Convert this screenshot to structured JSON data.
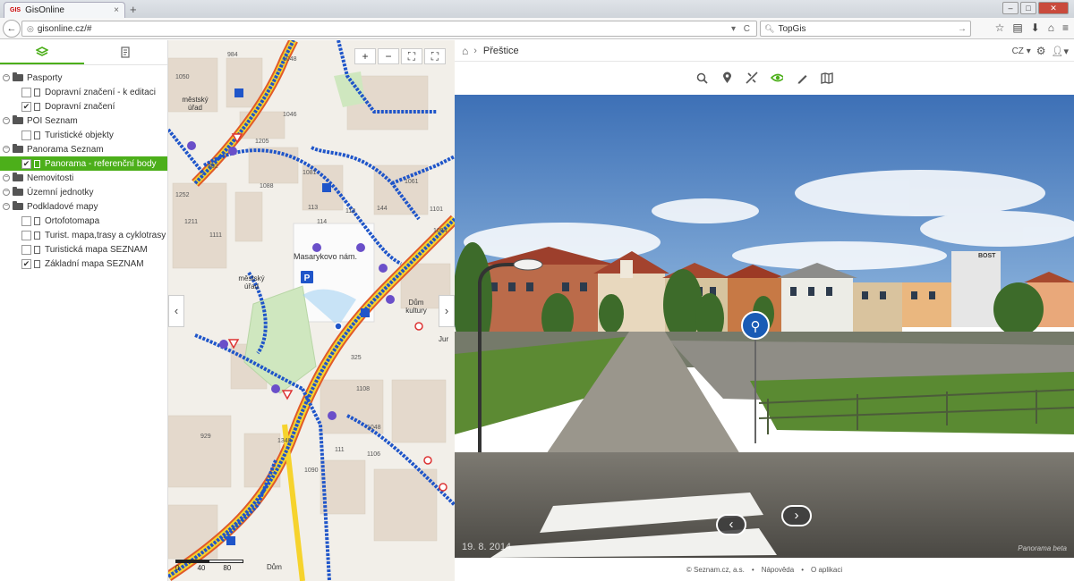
{
  "browser": {
    "tab_title": "GisOnline",
    "tab_favicon": "GIS",
    "url": "gisonline.cz/#",
    "search_value": "TopGis"
  },
  "panel": {
    "tree": [
      {
        "type": "group",
        "label": "Pasporty"
      },
      {
        "type": "item",
        "label": "Dopravní značení - k editaci",
        "checked": false
      },
      {
        "type": "item",
        "label": "Dopravní značení",
        "checked": true
      },
      {
        "type": "group",
        "label": "POI Seznam"
      },
      {
        "type": "item",
        "label": "Turistické objekty",
        "checked": false
      },
      {
        "type": "group",
        "label": "Panorama Seznam"
      },
      {
        "type": "item",
        "label": "Panorama - referenční body",
        "checked": true,
        "selected": true
      },
      {
        "type": "group",
        "label": "Nemovitosti"
      },
      {
        "type": "group",
        "label": "Územní jednotky"
      },
      {
        "type": "group",
        "label": "Podkladové mapy"
      },
      {
        "type": "item",
        "label": "Ortofotomapa",
        "checked": false
      },
      {
        "type": "item",
        "label": "Turist. mapa,trasy a cyklotrasy",
        "checked": false
      },
      {
        "type": "item",
        "label": "Turistická mapa SEZNAM",
        "checked": false
      },
      {
        "type": "item",
        "label": "Základní mapa SEZNAM",
        "checked": true
      }
    ]
  },
  "map": {
    "labels": {
      "square": "Masarykovo nám.",
      "office1": "městský úřad",
      "office2": "městský úřad",
      "culture": "Dům kultury",
      "house": "Dům",
      "street": "Jur"
    },
    "numbers": [
      "1050",
      "984",
      "1048",
      "1046",
      "862",
      "1205",
      "1088",
      "1252",
      "1211",
      "1111",
      "1081",
      "1061",
      "144",
      "112",
      "113",
      "114",
      "1101",
      "1094",
      "325",
      "1108",
      "929",
      "1048",
      "1106",
      "1348",
      "1090",
      "111"
    ],
    "scale_0": "0",
    "scale_40": "40",
    "scale_80": "80"
  },
  "right": {
    "breadcrumb": "Přeštice",
    "lang": "CZ",
    "pano_date": "19. 8. 2014",
    "pano_brand": "Panorama beta",
    "footer_copy": "© Seznam.cz, a.s.",
    "footer_help": "Nápověda",
    "footer_about": "O aplikaci",
    "building_sign": "BOST"
  },
  "colors": {
    "accent": "#4caf1a",
    "road_yellow": "#f6d32d",
    "road_red": "#e05a2a",
    "route_blue": "#1f55c9"
  }
}
